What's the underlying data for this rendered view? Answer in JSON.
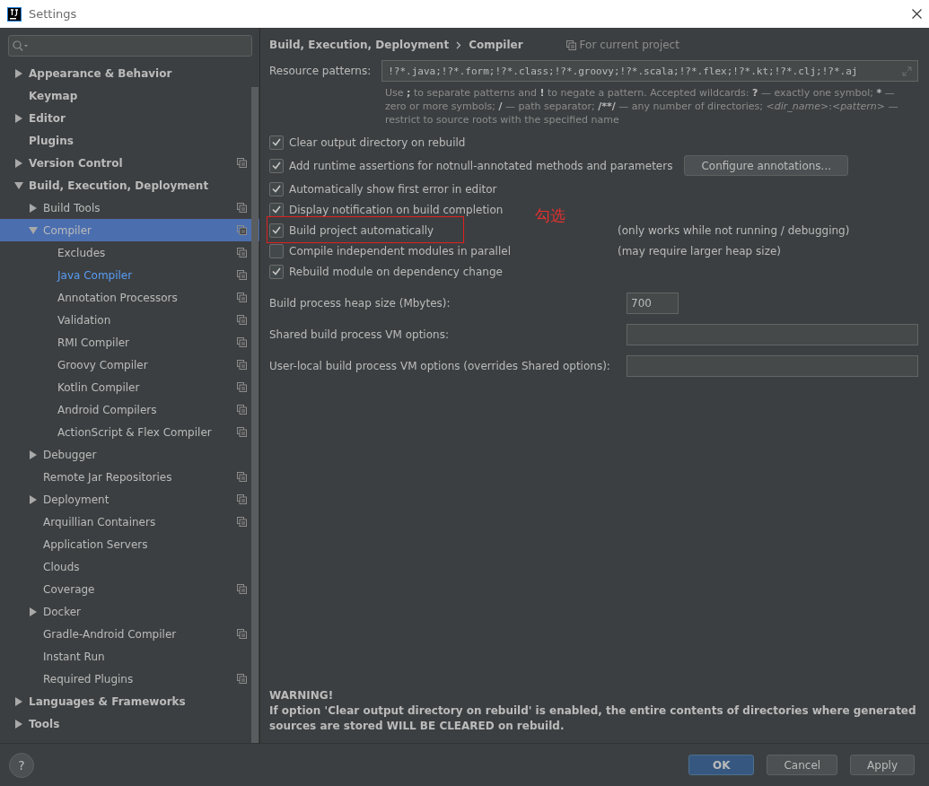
{
  "window": {
    "title": "Settings"
  },
  "tree": [
    {
      "label": "Appearance & Behavior",
      "kind": "section",
      "expanded": false,
      "selected": false,
      "project": false,
      "highlighted": false
    },
    {
      "label": "Keymap",
      "kind": "section",
      "selected": false,
      "project": false,
      "highlighted": false
    },
    {
      "label": "Editor",
      "kind": "section",
      "expanded": false,
      "selected": false,
      "project": false,
      "highlighted": false
    },
    {
      "label": "Plugins",
      "kind": "section",
      "selected": false,
      "project": false,
      "highlighted": false
    },
    {
      "label": "Version Control",
      "kind": "section",
      "expanded": false,
      "selected": false,
      "project": true,
      "highlighted": false
    },
    {
      "label": "Build, Execution, Deployment",
      "kind": "section",
      "expanded": true,
      "selected": false,
      "project": false,
      "highlighted": false,
      "children": [
        {
          "label": "Build Tools",
          "expanded": false,
          "selected": false,
          "project": true,
          "highlighted": false
        },
        {
          "label": "Compiler",
          "expanded": true,
          "selected": true,
          "project": true,
          "highlighted": false,
          "children": [
            {
              "label": "Excludes",
              "selected": false,
              "project": true,
              "highlighted": false
            },
            {
              "label": "Java Compiler",
              "selected": false,
              "project": true,
              "highlighted": true
            },
            {
              "label": "Annotation Processors",
              "selected": false,
              "project": true,
              "highlighted": false
            },
            {
              "label": "Validation",
              "selected": false,
              "project": true,
              "highlighted": false
            },
            {
              "label": "RMI Compiler",
              "selected": false,
              "project": true,
              "highlighted": false
            },
            {
              "label": "Groovy Compiler",
              "selected": false,
              "project": true,
              "highlighted": false
            },
            {
              "label": "Kotlin Compiler",
              "selected": false,
              "project": true,
              "highlighted": false
            },
            {
              "label": "Android Compilers",
              "selected": false,
              "project": true,
              "highlighted": false
            },
            {
              "label": "ActionScript & Flex Compiler",
              "selected": false,
              "project": true,
              "highlighted": false
            }
          ]
        },
        {
          "label": "Debugger",
          "expanded": false,
          "selected": false,
          "project": false,
          "highlighted": false
        },
        {
          "label": "Remote Jar Repositories",
          "selected": false,
          "project": true,
          "highlighted": false
        },
        {
          "label": "Deployment",
          "expanded": false,
          "selected": false,
          "project": true,
          "highlighted": false
        },
        {
          "label": "Arquillian Containers",
          "selected": false,
          "project": true,
          "highlighted": false
        },
        {
          "label": "Application Servers",
          "selected": false,
          "project": false,
          "highlighted": false
        },
        {
          "label": "Clouds",
          "selected": false,
          "project": false,
          "highlighted": false
        },
        {
          "label": "Coverage",
          "selected": false,
          "project": true,
          "highlighted": false
        },
        {
          "label": "Docker",
          "expanded": false,
          "selected": false,
          "project": false,
          "highlighted": false
        },
        {
          "label": "Gradle-Android Compiler",
          "selected": false,
          "project": true,
          "highlighted": false
        },
        {
          "label": "Instant Run",
          "selected": false,
          "project": false,
          "highlighted": false
        },
        {
          "label": "Required Plugins",
          "selected": false,
          "project": true,
          "highlighted": false
        }
      ]
    },
    {
      "label": "Languages & Frameworks",
      "kind": "section",
      "expanded": false,
      "selected": false,
      "project": false,
      "highlighted": false
    },
    {
      "label": "Tools",
      "kind": "section",
      "expanded": false,
      "selected": false,
      "project": false,
      "highlighted": false
    }
  ],
  "breadcrumb": [
    "Build, Execution, Deployment",
    "Compiler"
  ],
  "scope_label": "For current project",
  "resource_patterns": {
    "label": "Resource patterns:",
    "value": "!?*.java;!?*.form;!?*.class;!?*.groovy;!?*.scala;!?*.flex;!?*.kt;!?*.clj;!?*.aj",
    "help": [
      {
        "kind": "plain",
        "text": "Use "
      },
      {
        "kind": "bold",
        "text": ";"
      },
      {
        "kind": "plain",
        "text": " to separate patterns and "
      },
      {
        "kind": "bold",
        "text": "!"
      },
      {
        "kind": "plain",
        "text": " to negate a pattern. Accepted wildcards: "
      },
      {
        "kind": "bold",
        "text": "?"
      },
      {
        "kind": "plain",
        "text": " — exactly one symbol; "
      },
      {
        "kind": "bold",
        "text": "*"
      },
      {
        "kind": "plain",
        "text": " — zero or more symbols; "
      },
      {
        "kind": "bold",
        "text": "/"
      },
      {
        "kind": "plain",
        "text": " — path separator; "
      },
      {
        "kind": "bold",
        "text": "/**/"
      },
      {
        "kind": "plain",
        "text": " — any number of directories; "
      },
      {
        "kind": "italic",
        "text": "<dir_name>"
      },
      {
        "kind": "plain",
        "text": ":"
      },
      {
        "kind": "italic",
        "text": "<pattern>"
      },
      {
        "kind": "plain",
        "text": " — restrict to source roots with the specified name"
      }
    ]
  },
  "options": [
    {
      "label": "Clear output directory on rebuild",
      "checked": true
    },
    {
      "label": "Add runtime assertions for notnull-annotated methods and parameters",
      "checked": true,
      "button": "Configure annotations..."
    },
    {
      "label": "Automatically show first error in editor",
      "checked": true
    },
    {
      "label": "Display notification on build completion",
      "checked": true
    },
    {
      "label": "Build project automatically",
      "checked": true,
      "note": "(only works while not running / debugging)",
      "annotation": "勾选"
    },
    {
      "label": "Compile independent modules in parallel",
      "checked": false,
      "note": "(may require larger heap size)"
    },
    {
      "label": "Rebuild module on dependency change",
      "checked": true
    }
  ],
  "fields": [
    {
      "label": "Build process heap size (Mbytes):",
      "value": "700",
      "kind": "short"
    },
    {
      "label": "Shared build process VM options:",
      "kind": "wide"
    },
    {
      "label": "User-local build process VM options (overrides Shared options):",
      "kind": "wide"
    }
  ],
  "warning": {
    "title": "WARNING!",
    "text": "If option 'Clear output directory on rebuild' is enabled, the entire contents of directories where generated sources are stored WILL BE CLEARED on rebuild."
  },
  "help_button": {
    "label": "?"
  },
  "buttons": [
    {
      "label": "OK",
      "kind": "primary"
    },
    {
      "label": "Cancel",
      "kind": "normal"
    },
    {
      "label": "Apply",
      "kind": "normal"
    }
  ]
}
